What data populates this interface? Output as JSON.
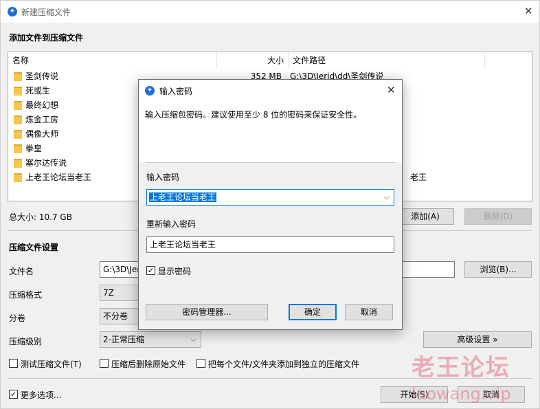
{
  "main": {
    "title": "新建压缩文件",
    "add_section_title": "添加文件到压缩文件",
    "columns": [
      "名称",
      "大小",
      "文件路径"
    ],
    "files": [
      {
        "name": "圣剑传说",
        "size": "352 MB",
        "path": "G:\\3D\\Jerid\\dd\\圣剑传说"
      },
      {
        "name": "死或生",
        "size": "",
        "path": ""
      },
      {
        "name": "最终幻想",
        "size": "",
        "path": ""
      },
      {
        "name": "炼金工房",
        "size": "",
        "path": ""
      },
      {
        "name": "偶像大师",
        "size": "",
        "path": ""
      },
      {
        "name": "拳皇",
        "size": "",
        "path": ""
      },
      {
        "name": "塞尔达传说",
        "size": "",
        "path": ""
      },
      {
        "name": "上老王论坛当老王",
        "size": "",
        "path": "老王"
      }
    ],
    "total_size": "总大小: 10.7 GB",
    "add_button": "添加(A)",
    "delete_button": "删除(D)",
    "settings_title": "压缩文件设置",
    "filename_label": "文件名",
    "filename_value": "G:\\3D\\Jeri",
    "browse_button": "浏览(B)...",
    "format_label": "压缩格式",
    "format_value": "7Z",
    "volume_label": "分卷",
    "volume_value": "不分卷",
    "level_label": "压缩级别",
    "level_value": "2-正常压缩",
    "advanced_button": "高级设置 »",
    "opt_test": "测试压缩文件(T)",
    "opt_delete_src": "压缩后删除原始文件",
    "opt_separate": "把每个文件/文件夹添加到独立的压缩文件",
    "more_options": "更多选项...",
    "start_button": "开始(S)",
    "cancel_button": "取消"
  },
  "dialog": {
    "title": "输入密码",
    "description": "输入压缩包密码。建议使用至少 8 位的密码来保证安全性。",
    "password_label": "输入密码",
    "password_value": "上老王论坛当老王",
    "confirm_label": "重新输入密码",
    "confirm_value": "上老王论坛当老王",
    "show_password": "显示密码",
    "manager_button": "密码管理器...",
    "ok_button": "确定",
    "cancel_button": "取消"
  },
  "watermark": {
    "line1": "老王论坛",
    "line2": "laowang.vip"
  },
  "colors": {
    "accent": "#0078d7",
    "app_icon": "#1f6fd6",
    "folder": "#f4c84e",
    "watermark": "#e05a6e"
  }
}
